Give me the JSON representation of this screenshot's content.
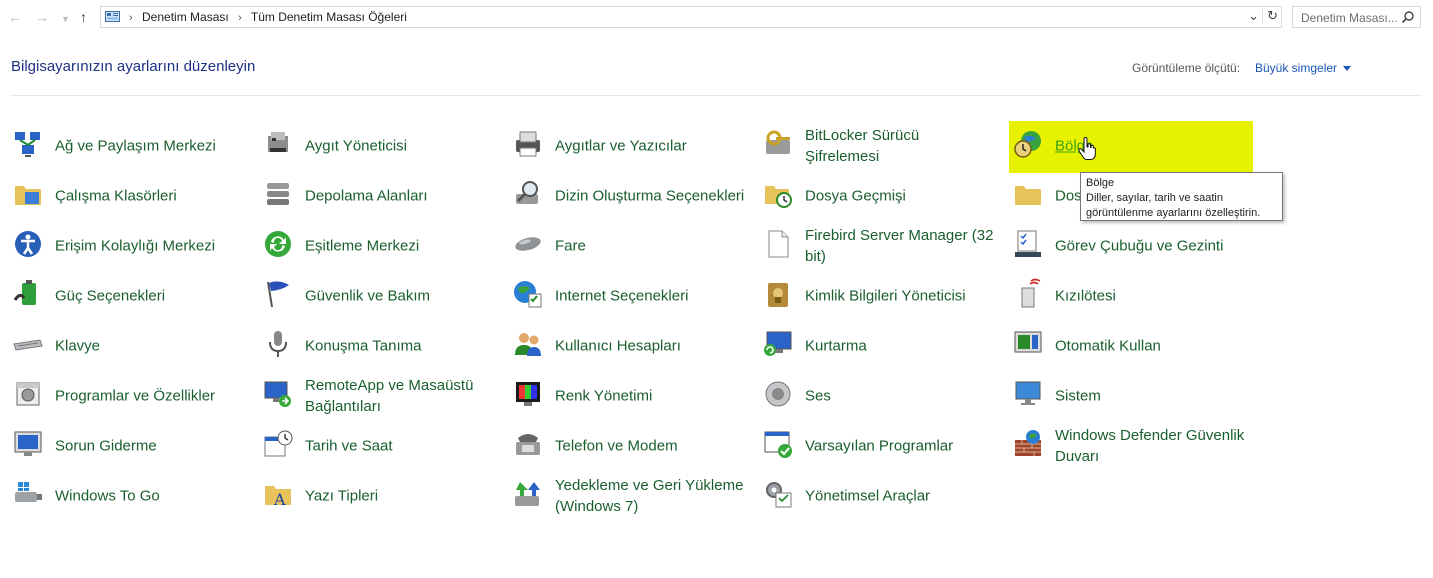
{
  "nav": {
    "breadcrumb": [
      "Denetim Masası",
      "Tüm Denetim Masası Öğeleri"
    ],
    "search_placeholder": "Denetim Masası..."
  },
  "header": {
    "title": "Bilgisayarınızın ayarlarını düzenleyin",
    "view_label": "Görüntüleme ölçütü:",
    "view_value": "Büyük simgeler"
  },
  "items": [
    {
      "label": "Ağ ve Paylaşım Merkezi",
      "icon": "network-icon"
    },
    {
      "label": "Aygıt Yöneticisi",
      "icon": "device-manager-icon"
    },
    {
      "label": "Aygıtlar ve Yazıcılar",
      "icon": "printer-icon"
    },
    {
      "label": "BitLocker Sürücü Şifrelemesi",
      "icon": "bitlocker-icon"
    },
    {
      "label": "Bölge",
      "icon": "region-icon"
    },
    {
      "label": "Çalışma Klasörleri",
      "icon": "work-folders-icon"
    },
    {
      "label": "Depolama Alanları",
      "icon": "storage-spaces-icon"
    },
    {
      "label": "Dizin Oluşturma Seçenekleri",
      "icon": "indexing-icon"
    },
    {
      "label": "Dosya Geçmişi",
      "icon": "file-history-icon"
    },
    {
      "label": "Dos",
      "icon": "folder-options-icon"
    },
    {
      "label": "Erişim Kolaylığı Merkezi",
      "icon": "ease-of-access-icon"
    },
    {
      "label": "Eşitleme Merkezi",
      "icon": "sync-center-icon"
    },
    {
      "label": "Fare",
      "icon": "mouse-icon"
    },
    {
      "label": "Firebird Server Manager (32 bit)",
      "icon": "document-icon"
    },
    {
      "label": "Görev Çubuğu ve Gezinti",
      "icon": "taskbar-icon"
    },
    {
      "label": "Güç Seçenekleri",
      "icon": "power-icon"
    },
    {
      "label": "Güvenlik ve Bakım",
      "icon": "flag-icon"
    },
    {
      "label": "Internet Seçenekleri",
      "icon": "internet-icon"
    },
    {
      "label": "Kimlik Bilgileri Yöneticisi",
      "icon": "credential-icon"
    },
    {
      "label": "Kızılötesi",
      "icon": "infrared-icon"
    },
    {
      "label": "Klavye",
      "icon": "keyboard-icon"
    },
    {
      "label": "Konuşma Tanıma",
      "icon": "microphone-icon"
    },
    {
      "label": "Kullanıcı Hesapları",
      "icon": "users-icon"
    },
    {
      "label": "Kurtarma",
      "icon": "recovery-icon"
    },
    {
      "label": "Otomatik Kullan",
      "icon": "autoplay-icon"
    },
    {
      "label": "Programlar ve Özellikler",
      "icon": "programs-icon"
    },
    {
      "label": "RemoteApp ve Masaüstü Bağlantıları",
      "icon": "remoteapp-icon"
    },
    {
      "label": "Renk Yönetimi",
      "icon": "color-management-icon"
    },
    {
      "label": "Ses",
      "icon": "speaker-icon"
    },
    {
      "label": "Sistem",
      "icon": "system-icon"
    },
    {
      "label": "Sorun Giderme",
      "icon": "troubleshoot-icon"
    },
    {
      "label": "Tarih ve Saat",
      "icon": "calendar-icon"
    },
    {
      "label": "Telefon ve Modem",
      "icon": "phone-icon"
    },
    {
      "label": "Varsayılan Programlar",
      "icon": "default-programs-icon"
    },
    {
      "label": "Windows Defender Güvenlik Duvarı",
      "icon": "firewall-icon"
    },
    {
      "label": "Windows To Go",
      "icon": "windows-to-go-icon"
    },
    {
      "label": "Yazı Tipleri",
      "icon": "fonts-icon"
    },
    {
      "label": "Yedekleme ve Geri Yükleme (Windows 7)",
      "icon": "backup-icon"
    },
    {
      "label": "Yönetimsel Araçlar",
      "icon": "admin-tools-icon"
    }
  ],
  "tooltip": {
    "title": "Bölge",
    "text": "Diller, sayılar, tarih ve saatin görüntülenme ayarlarını özelleştirin."
  }
}
